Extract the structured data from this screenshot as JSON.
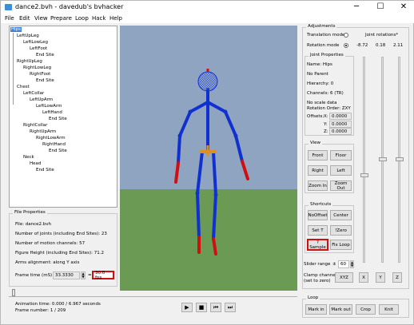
{
  "window": {
    "title": "dance2.bvh - davedub's bvhacker",
    "minimize": "─",
    "maximize": "☐",
    "close": "✕"
  },
  "menu": [
    "File",
    "Edit",
    "View",
    "Prepare",
    "Loop",
    "Hack",
    "Help"
  ],
  "tree": [
    {
      "label": "Hips",
      "selected": true
    },
    {
      "label": "LeftUpLeg"
    },
    {
      "label": "LeftLowLeg"
    },
    {
      "label": "LeftFoot"
    },
    {
      "label": "End Site"
    },
    {
      "label": "RightUpLeg"
    },
    {
      "label": "RightLowLeg"
    },
    {
      "label": "RightFoot"
    },
    {
      "label": "End Site"
    },
    {
      "label": "Chest"
    },
    {
      "label": "LeftCollar"
    },
    {
      "label": "LeftUpArm"
    },
    {
      "label": "LeftLowArm"
    },
    {
      "label": "LeftHand"
    },
    {
      "label": "End Site"
    },
    {
      "label": "RightCollar"
    },
    {
      "label": "RightUpArm"
    },
    {
      "label": "RightLowArm"
    },
    {
      "label": "RightHand"
    },
    {
      "label": "End Site"
    },
    {
      "label": "Neck"
    },
    {
      "label": "Head"
    },
    {
      "label": "End Site"
    }
  ],
  "file_props": {
    "title": "File Properties",
    "file": "File: dance2.bvh",
    "joints": "Number of joints (including End Sites): 23",
    "channels": "Number of motion channels: 57",
    "height": "Figure Height (including End Sites): 71.2",
    "arms": "Arms alignment: along Y axis",
    "frame_time_label": "Frame time (mS)",
    "frame_time_value": "33.3330",
    "equals": "=",
    "fps": "30.0 fps"
  },
  "timeline": {
    "animation_time": "Animation time: 0.000 / 6.967 seconds",
    "frame_number": "Frame number: 1 / 209",
    "progress": 0.0
  },
  "adjustments": {
    "title": "Adjustments",
    "translation_mode": "Translation mode",
    "joint_rotations": "Joint rotations*",
    "rotation_mode": "Rotation mode",
    "rot_x": "-8.72",
    "rot_y": "0.18",
    "rot_z": "2.11"
  },
  "joint_props": {
    "title": "Joint Properties",
    "name": "Name: Hips",
    "parent": "No Parent",
    "hierarchy": "Hierarchy: 0",
    "channels": "Channels: 6 (TR)",
    "scale": "No scale data",
    "rot_order": "Rotation Order: ZXY",
    "offsets_label": "Offsets:",
    "x_label": "X:",
    "x": "0.0000",
    "y_label": "Y:",
    "y": "0.0000",
    "z_label": "Z:",
    "z": "0.0000"
  },
  "view": {
    "title": "View",
    "front": "Front",
    "floor": "Floor",
    "right": "Right",
    "left": "Left",
    "zoom_in": "Zoom In",
    "zoom_out": "Zoom Out"
  },
  "shortcuts": {
    "title": "Shortcuts",
    "nooffset": "NoOffset",
    "center": "Center",
    "set_t": "Set T",
    "izero": "!Zero",
    "sample": "?Sample",
    "fix_loop": "Fix Loop"
  },
  "slider_range": {
    "label": "Slider range",
    "plusminus": "±",
    "value": "60"
  },
  "clamp": {
    "label1": "Clamp channel",
    "label2": "(set to zero)",
    "xyz": "XYZ",
    "x": "X",
    "y": "Y",
    "z": "Z"
  },
  "loop": {
    "title": "Loop",
    "mark_in": "Mark in",
    "mark_out": "Mark out",
    "crop": "Crop",
    "knit": "Knit"
  },
  "playback": {
    "play": "▶",
    "stop": "■",
    "prev": "⏮",
    "next": "⏭"
  },
  "colors": {
    "accent_red": "#d01010",
    "skeleton": "#1030d0",
    "sky": "#8fa4c0",
    "floor": "#6b9a55"
  }
}
